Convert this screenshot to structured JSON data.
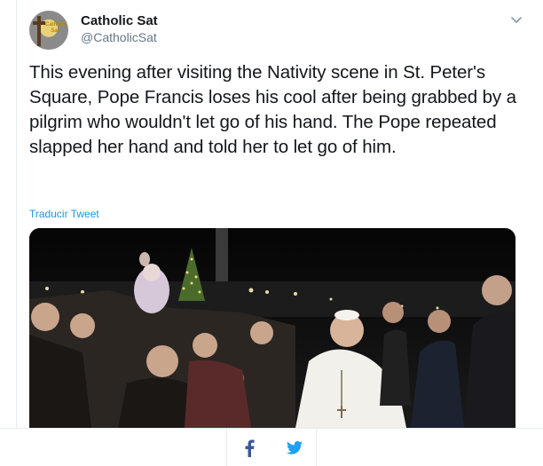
{
  "tweet": {
    "display_name": "Catholic Sat",
    "handle": "@CatholicSat",
    "avatar_text": "Catholic Sat",
    "text": "This evening after visiting the Nativity scene in St. Peter's Square, Pope Francis loses his cool after being grabbed by a pilgrim who wouldn't let go of his hand. The Pope repeated slapped her hand and told her to let go of him.",
    "translate_label": "Traducir Tweet",
    "media_description": "photo",
    "menu_icon": "chevron-down-icon"
  },
  "share": {
    "facebook_icon": "facebook-icon",
    "twitter_icon": "twitter-icon"
  },
  "colors": {
    "link": "#1b95e0",
    "text": "#14171a",
    "muted": "#657786",
    "facebook": "#3b5998",
    "twitter": "#1da1f2",
    "divider": "#e6ecf0"
  }
}
